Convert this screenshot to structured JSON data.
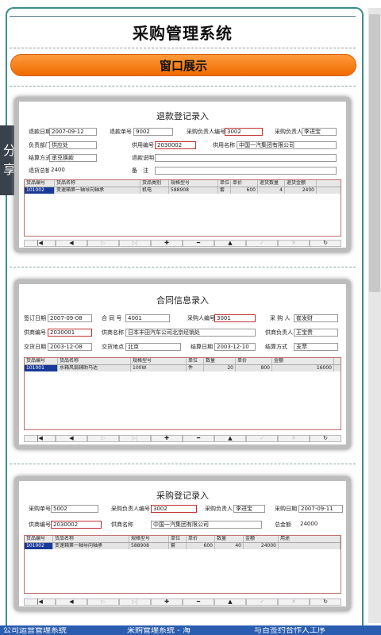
{
  "app": {
    "title": "采购管理系统",
    "banner": "窗口展示",
    "share_label": "分享"
  },
  "colors": {
    "accent": "#f07a10",
    "border": "#3d8e8a",
    "selection": "#1a3a9a"
  },
  "nav_buttons": [
    "|◀",
    "◀",
    "▷",
    "▷|",
    "✚",
    "━",
    "▲",
    "✓",
    "✕",
    "↻"
  ],
  "nav_dim": [
    false,
    false,
    true,
    true,
    false,
    false,
    false,
    true,
    true,
    false
  ],
  "window1": {
    "title": "退款登记录入",
    "labels": {
      "date": "退款日期",
      "no": "退款单号",
      "buyer_id": "采购负责人编号",
      "buyer": "采购负责人",
      "dept": "负责部门",
      "supplier_no": "供用编号",
      "supplier_name": "供用名称",
      "settle": "结算方式",
      "desc": "退款说明",
      "total": "退货总额",
      "remark": "备　注"
    },
    "values": {
      "date": "2007-09-12",
      "no": "9002",
      "buyer_id": "3002",
      "buyer": "李进宝",
      "dept": "供应处",
      "supplier_no": "2030002",
      "supplier_name": "中国一汽集团有限公司",
      "settle": "承兑换款",
      "desc": "",
      "total": "2400",
      "remark": ""
    },
    "columns": [
      "货品编号",
      "货品名称",
      "货品类别",
      "规格型号",
      "单位",
      "单价",
      "退货数量",
      "退货金额"
    ],
    "rows": [
      [
        "101002",
        "变速箱第一轴导向轴承",
        "机电",
        "588908",
        "套",
        "600",
        "4",
        "2400"
      ]
    ]
  },
  "window2": {
    "title": "合同信息录入",
    "labels": {
      "sign_date": "签订日期",
      "contract_no": "合 同 号",
      "buyer_id": "采购人编号",
      "buyer": "采 购 人",
      "supplier_no": "供商编号",
      "supplier_name": "供商名称",
      "supplier_person": "供商负责人",
      "deliver_date": "交货日期",
      "deliver_place": "交货地点",
      "settle_date": "结算日期",
      "settle": "结算方式"
    },
    "values": {
      "sign_date": "2007-09-08",
      "contract_no": "4001",
      "buyer_id": "3001",
      "buyer": "崔发财",
      "supplier_no": "2030001",
      "supplier_name": "日本丰田汽车公司北京经销处",
      "supplier_person": "王宝贵",
      "deliver_date": "2003-12-08",
      "deliver_place": "北京",
      "settle_date": "2003-12-10",
      "settle": "支票"
    },
    "columns": [
      "货品编号",
      "货品名称",
      "规格型号",
      "单位",
      "数量",
      "单价",
      "金额"
    ],
    "rows": [
      [
        "101001",
        "水箱风扇辅助马达",
        "100W",
        "件",
        "20",
        "800",
        "16000"
      ]
    ]
  },
  "window3": {
    "title": "采购登记录入",
    "labels": {
      "no": "采购单号",
      "buyer_id": "采购负责人编号",
      "buyer": "采购负责人",
      "date": "采购日期",
      "supplier_no": "供商编号",
      "supplier_name": "供商名称",
      "total": "总金额"
    },
    "values": {
      "no": "5002",
      "buyer_id": "3002",
      "buyer": "李进宝",
      "date": "2007-09-11",
      "supplier_no": "2030002",
      "supplier_name": "中国一汽集团有限公司",
      "total": "24000"
    },
    "columns": [
      "货品编号",
      "货品名称",
      "规格型号",
      "单位",
      "单价",
      "数量",
      "金额",
      "用途"
    ],
    "rows": [
      [
        "101002",
        "变速箱第一轴导向轴承",
        "588908",
        "套",
        "600",
        "40",
        "24000",
        ""
      ]
    ]
  },
  "taskbar": {
    "items": [
      "公司运营管理系统",
      "采购管理系统 - 海",
      "与百签约合作人工序"
    ]
  }
}
